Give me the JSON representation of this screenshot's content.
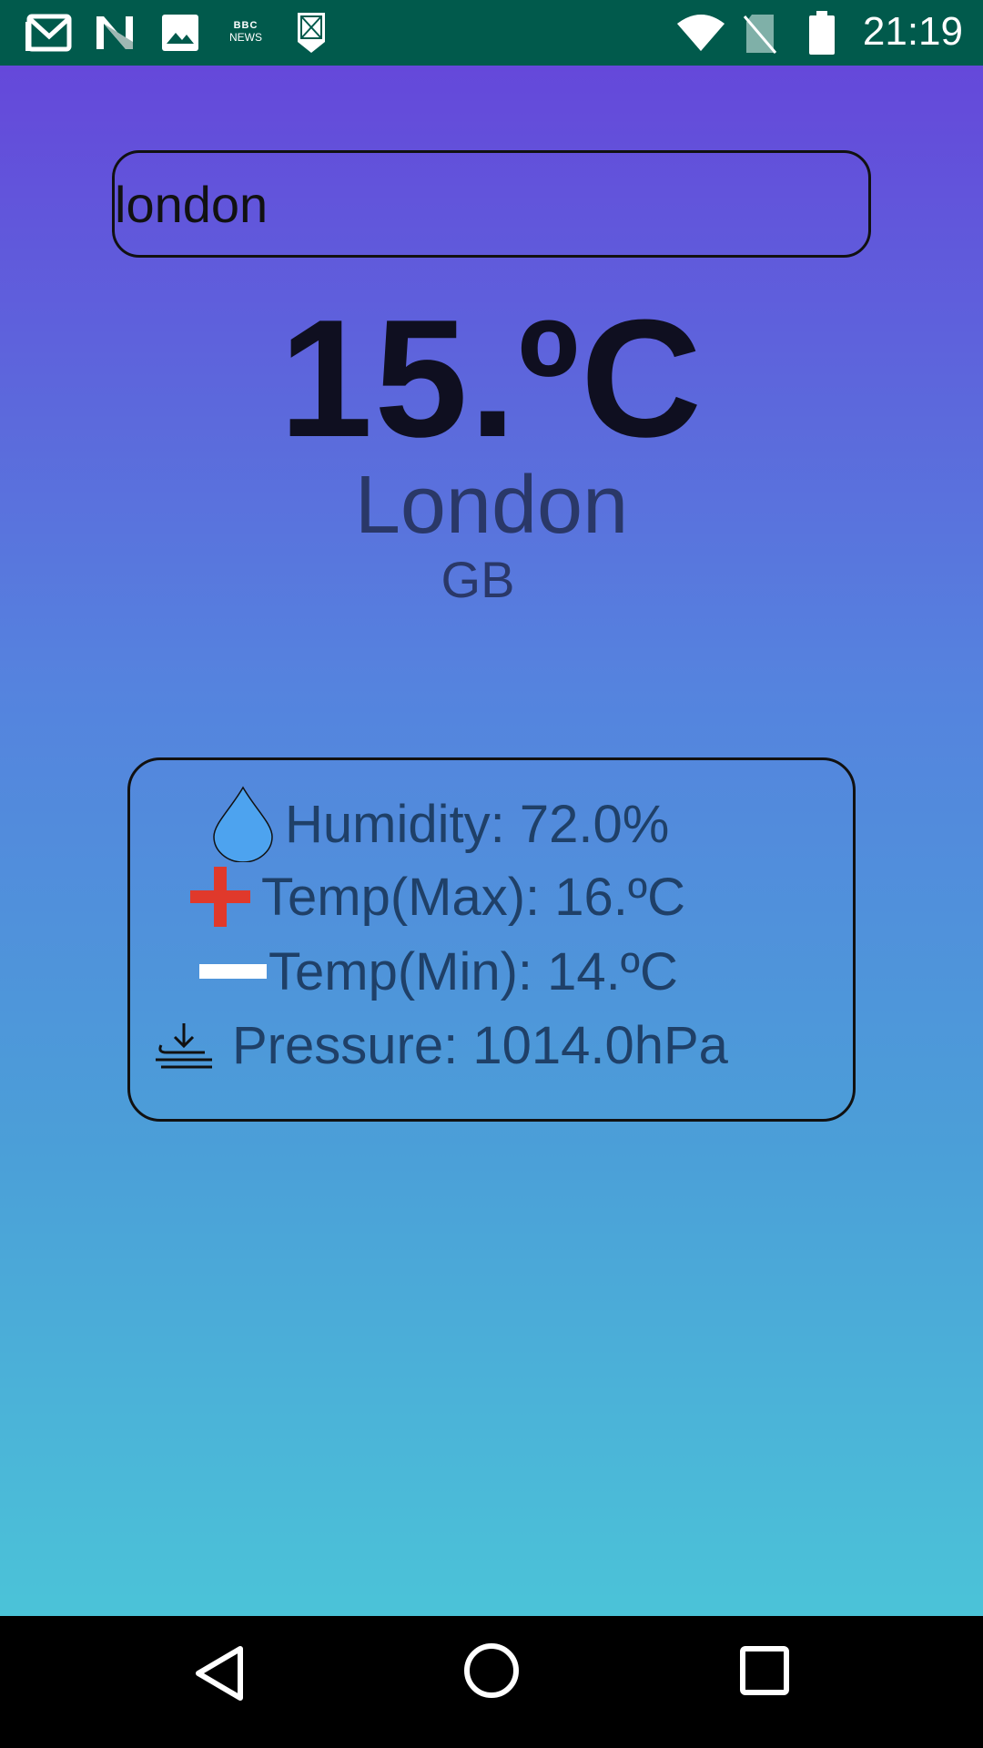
{
  "status_bar": {
    "time": "21:19",
    "left_icons": [
      "gmail-icon",
      "n-icon",
      "gallery-icon",
      "bbc-news-icon",
      "notification-icon"
    ],
    "bbc_line1": "BBC",
    "bbc_line2": "NEWS",
    "right_icons": [
      "wifi-icon",
      "no-sim-icon",
      "battery-icon"
    ]
  },
  "search": {
    "value": "london"
  },
  "weather": {
    "temperature": "15.ºC",
    "city": "London",
    "country": "GB"
  },
  "details": {
    "humidity": "Humidity: 72.0%",
    "temp_max": "Temp(Max): 16.ºC",
    "temp_min": "Temp(Min): 14.ºC",
    "pressure": "Pressure: 1014.0hPa"
  },
  "colors": {
    "status_bar": "#015a4c",
    "gradient_top": "#6548da",
    "gradient_bottom": "#4bc3d8",
    "drop": "#4da3ef",
    "plus": "#e0392b",
    "minus": "#ffffff",
    "detail_text": "#1f4068"
  },
  "nav_bar": {
    "buttons": [
      "back-icon",
      "home-icon",
      "recents-icon"
    ]
  }
}
